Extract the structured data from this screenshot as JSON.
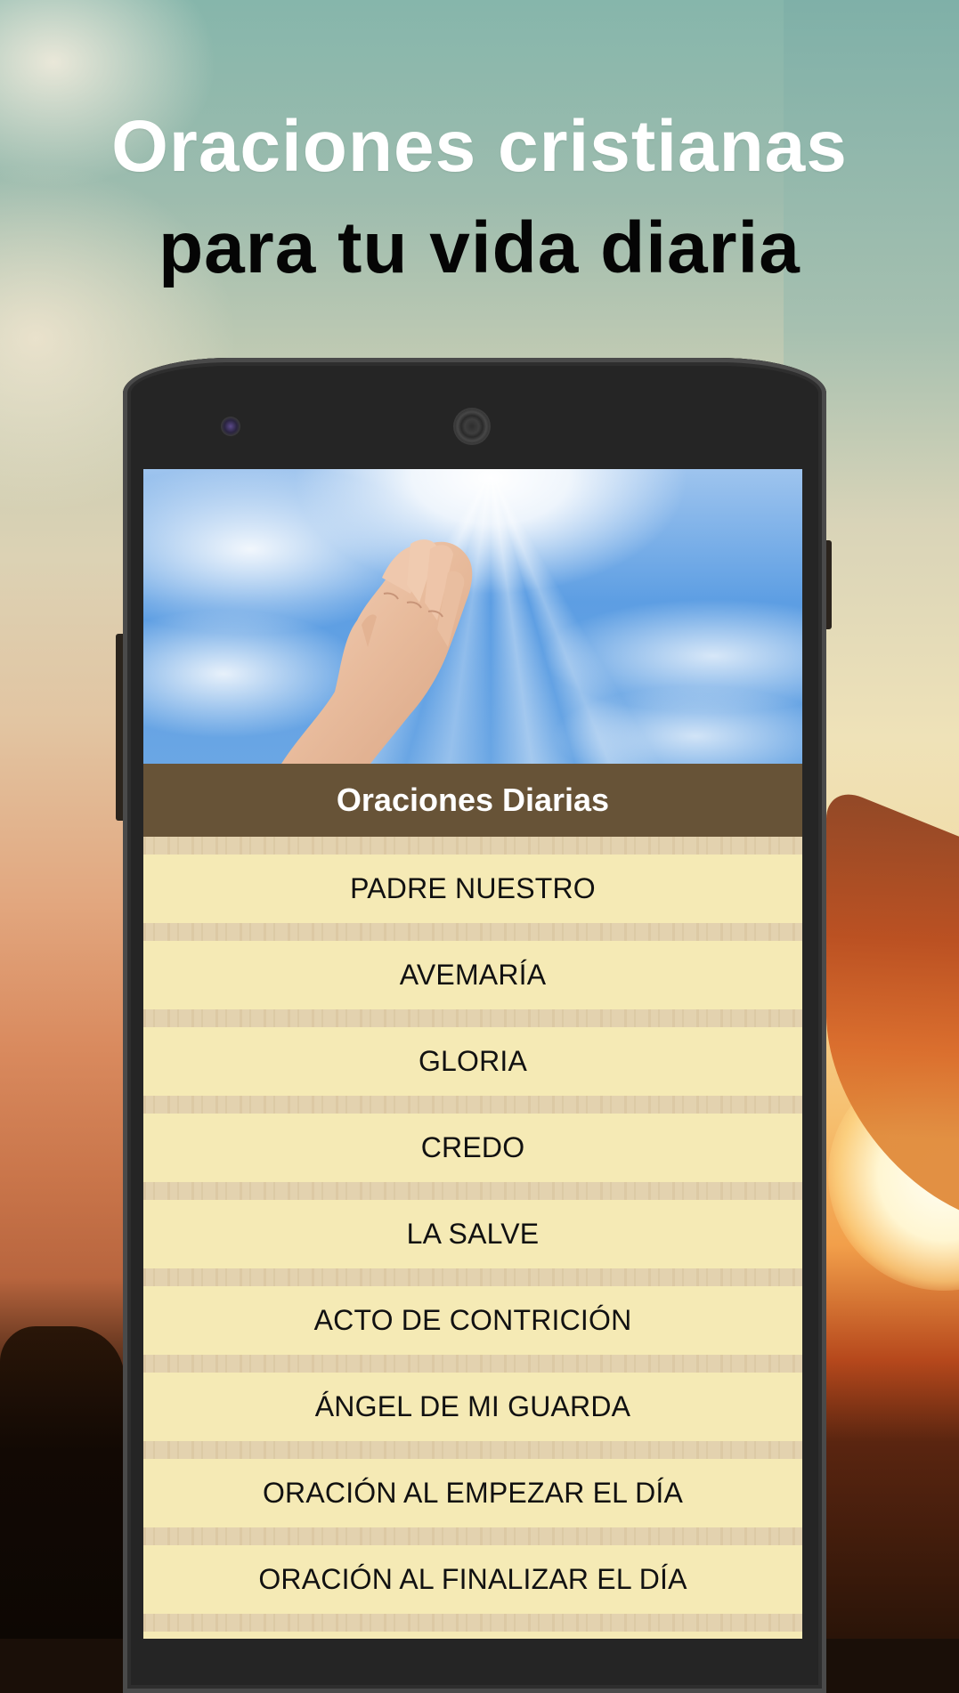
{
  "headline": {
    "line1": "Oraciones cristianas",
    "line2": "para tu vida diaria"
  },
  "app": {
    "title": "Oraciones Diarias",
    "hero_image": "praying-hands-sky-image",
    "colors": {
      "title_bar": "#675337",
      "list_background": "#f5eab5",
      "separator": "#e3d2af",
      "text": "#111111"
    }
  },
  "prayers": [
    {
      "label": "PADRE NUESTRO"
    },
    {
      "label": "AVEMARÍA"
    },
    {
      "label": "GLORIA"
    },
    {
      "label": "CREDO"
    },
    {
      "label": "LA SALVE"
    },
    {
      "label": "ACTO DE CONTRICIÓN"
    },
    {
      "label": "ÁNGEL DE MI GUARDA"
    },
    {
      "label": "ORACIÓN AL EMPEZAR EL DÍA"
    },
    {
      "label": "ORACIÓN AL FINALIZAR EL DÍA"
    }
  ]
}
